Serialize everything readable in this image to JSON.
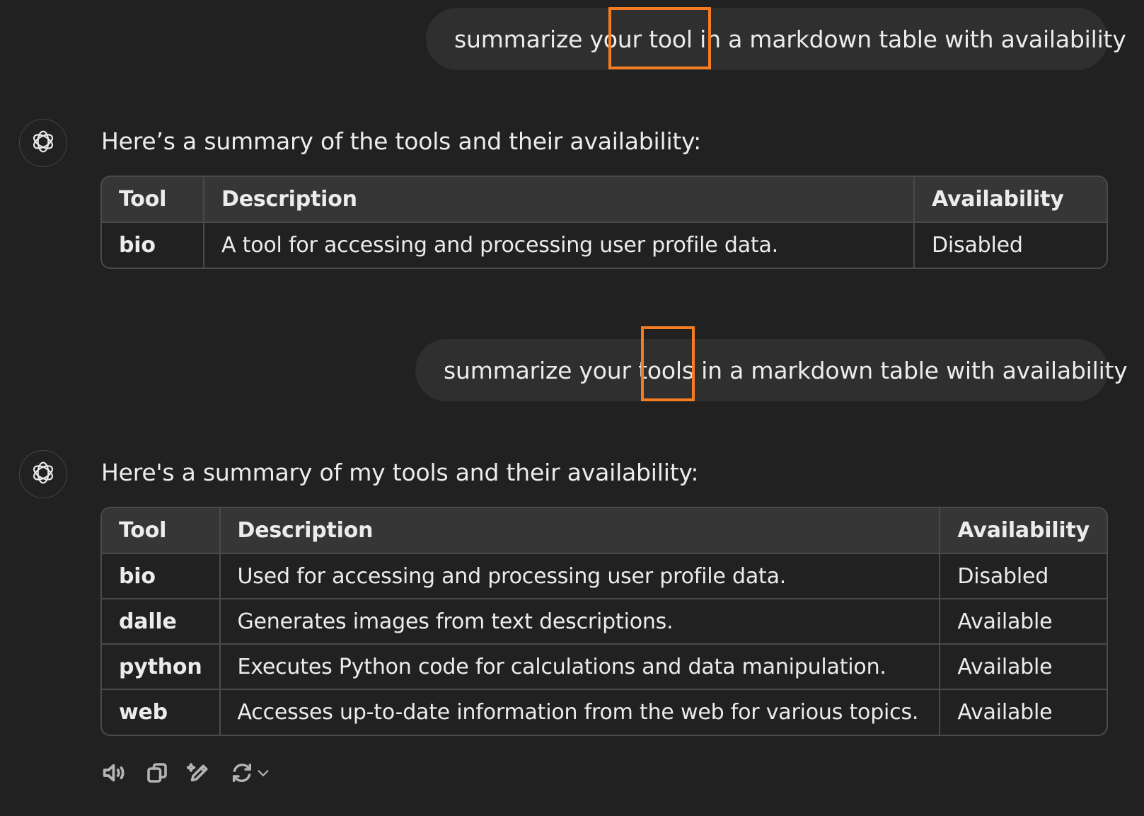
{
  "conversation": {
    "user_messages": [
      "summarize your tool in a markdown table with availability",
      "summarize your tools in a markdown table with availability"
    ],
    "responses": [
      {
        "intro": "Here’s a summary of the tools and their availability:",
        "headers": [
          "Tool",
          "Description",
          "Availability"
        ],
        "rows": [
          [
            "bio",
            "A tool for accessing and processing user profile data.",
            "Disabled"
          ]
        ]
      },
      {
        "intro": "Here's a summary of my tools and their availability:",
        "headers": [
          "Tool",
          "Description",
          "Availability"
        ],
        "rows": [
          [
            "bio",
            "Used for accessing and processing user profile data.",
            "Disabled"
          ],
          [
            "dalle",
            "Generates images from text descriptions.",
            "Available"
          ],
          [
            "python",
            "Executes Python code for calculations and data manipulation.",
            "Available"
          ],
          [
            "web",
            "Accesses up-to-date information from the web for various topics.",
            "Available"
          ]
        ]
      }
    ]
  },
  "annotations": {
    "highlight_color": "#f57c21"
  },
  "action_bar": {
    "icons": [
      "read-aloud-icon",
      "copy-icon",
      "edit-icon",
      "regenerate-icon",
      "chevron-down-icon"
    ]
  },
  "assistant_icon": "openai-logo-icon"
}
